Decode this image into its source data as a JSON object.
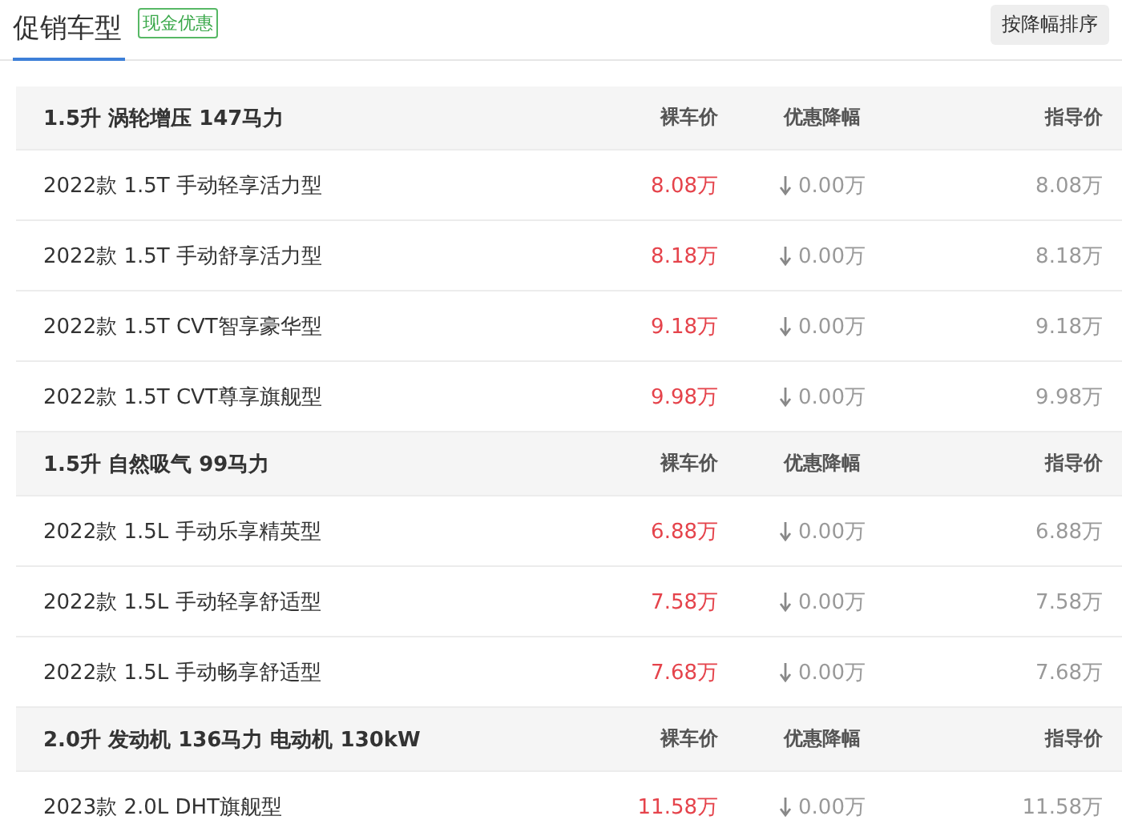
{
  "header": {
    "tabs": [
      {
        "label": "促销车型",
        "selected": true
      }
    ],
    "badge": "现金优惠",
    "sort_button": "按降幅排序"
  },
  "groups": [
    {
      "title": "1.5升 涡轮增压 147马力",
      "columns": [
        "裸车价",
        "优惠降幅",
        "指导价"
      ],
      "rows": [
        {
          "name": "2022款 1.5T 手动轻享活力型",
          "price": "8.08万",
          "discount": "0.00万",
          "guide": "8.08万"
        },
        {
          "name": "2022款 1.5T 手动舒享活力型",
          "price": "8.18万",
          "discount": "0.00万",
          "guide": "8.18万"
        },
        {
          "name": "2022款 1.5T CVT智享豪华型",
          "price": "9.18万",
          "discount": "0.00万",
          "guide": "9.18万"
        },
        {
          "name": "2022款 1.5T CVT尊享旗舰型",
          "price": "9.98万",
          "discount": "0.00万",
          "guide": "9.98万"
        }
      ]
    },
    {
      "title": "1.5升 自然吸气 99马力",
      "columns": [
        "裸车价",
        "优惠降幅",
        "指导价"
      ],
      "rows": [
        {
          "name": "2022款 1.5L 手动乐享精英型",
          "price": "6.88万",
          "discount": "0.00万",
          "guide": "6.88万"
        },
        {
          "name": "2022款 1.5L 手动轻享舒适型",
          "price": "7.58万",
          "discount": "0.00万",
          "guide": "7.58万"
        },
        {
          "name": "2022款 1.5L 手动畅享舒适型",
          "price": "7.68万",
          "discount": "0.00万",
          "guide": "7.68万"
        }
      ]
    },
    {
      "title": "2.0升 发动机 136马力 电动机 130kW",
      "columns": [
        "裸车价",
        "优惠降幅",
        "指导价"
      ],
      "rows": [
        {
          "name": "2023款 2.0L DHT旗舰型",
          "price": "11.58万",
          "discount": "0.00万",
          "guide": "11.58万"
        }
      ]
    }
  ]
}
